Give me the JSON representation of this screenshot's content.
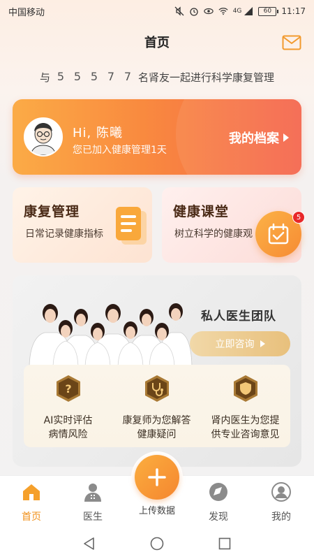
{
  "status_bar": {
    "carrier": "中国移动",
    "network": "4G",
    "battery": "60",
    "time": "11:17"
  },
  "header": {
    "title": "首页",
    "mail_icon": "mail-icon"
  },
  "counter": {
    "prefix": "与",
    "digits": [
      "5",
      "5",
      "5",
      "7",
      "7"
    ],
    "suffix": "名肾友一起进行科学康复管理"
  },
  "profile": {
    "greeting": "Hi, 陈曦",
    "joined": "您已加入健康管理1天",
    "my_file": "我的档案"
  },
  "features": {
    "rehab": {
      "title": "康复管理",
      "desc": "日常记录健康指标"
    },
    "class": {
      "title": "健康课堂",
      "desc": "树立科学的健康观"
    },
    "calendar_badge": "5"
  },
  "team": {
    "title": "私人医生团队",
    "consult": "立即咨询",
    "items": [
      {
        "icon": "question-icon",
        "line1": "AI实时评估",
        "line2": "病情风险"
      },
      {
        "icon": "stethoscope-icon",
        "line1": "康复师为您解答",
        "line2": "健康疑问"
      },
      {
        "icon": "shield-icon",
        "line1": "肾内医生为您提",
        "line2": "供专业咨询意见"
      }
    ]
  },
  "nav": {
    "home": "首页",
    "doctor": "医生",
    "upload": "上传数据",
    "discover": "发现",
    "mine": "我的"
  },
  "colors": {
    "accent": "#f5862f",
    "card_start": "#fbab46",
    "card_end": "#f5634a",
    "active_nav": "#f0901a"
  }
}
